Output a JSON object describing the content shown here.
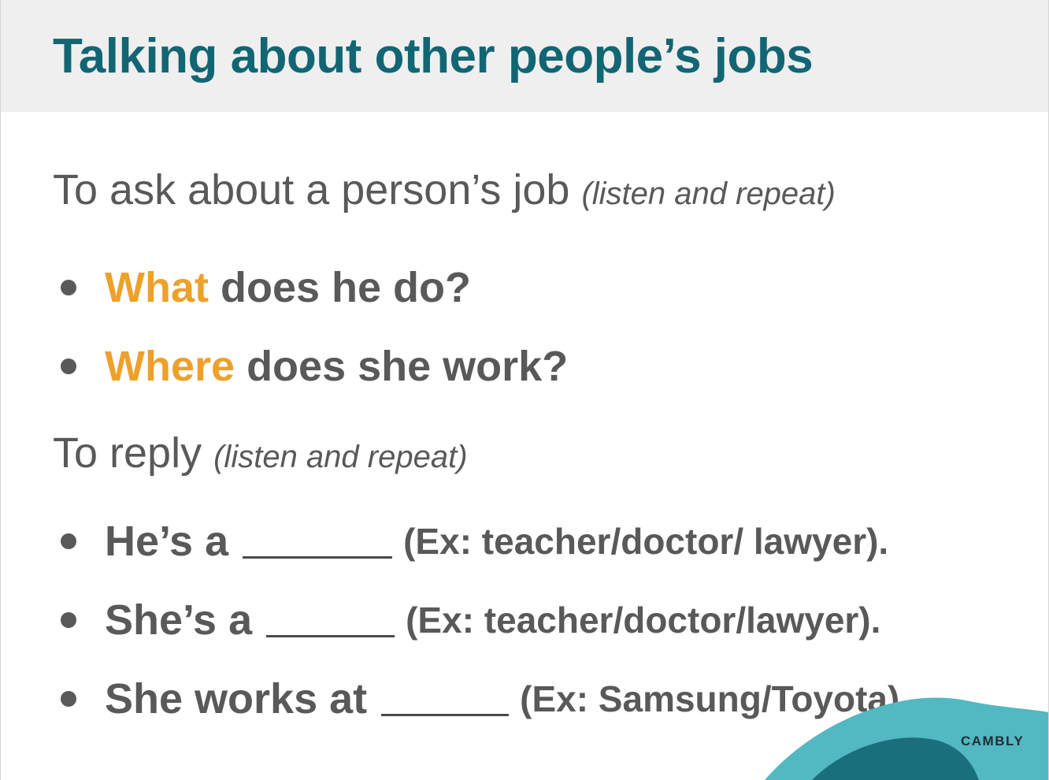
{
  "title": "Talking about other people’s jobs",
  "ask": {
    "intro": "To ask about a person’s job",
    "note": "(listen and repeat)",
    "items": [
      {
        "accent": "What",
        "rest": "does he do?"
      },
      {
        "accent": "Where",
        "rest": "does she work?"
      }
    ]
  },
  "reply": {
    "intro": "To reply",
    "note": "(listen and repeat)",
    "items": [
      {
        "lead": "He’s a",
        "example": "(Ex: teacher/doctor/ lawyer)."
      },
      {
        "lead": "She’s a",
        "example": "(Ex: teacher/doctor/lawyer)."
      },
      {
        "lead": "She works at",
        "example": "(Ex: Samsung/Toyota)."
      }
    ]
  },
  "brand": "CAMBLY",
  "colors": {
    "title": "#126673",
    "accent": "#eda12b",
    "body_text": "#595959",
    "header_band": "#efefef",
    "logo_light": "#52b8c1",
    "logo_dark": "#1a6f7c"
  }
}
